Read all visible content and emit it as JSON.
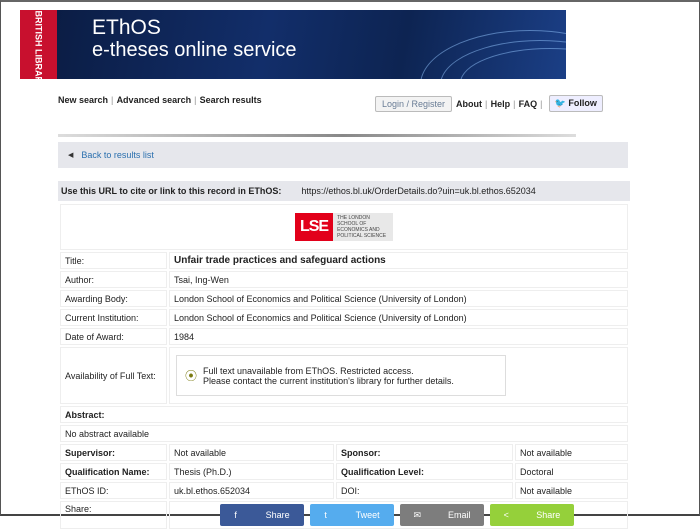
{
  "banner": {
    "logo": "BRITISH LIBRARY",
    "title": "EThOS",
    "subtitle": "e-theses online service"
  },
  "nav": {
    "left": [
      "New search",
      "Advanced search",
      "Search results"
    ],
    "login": "Login / Register",
    "right": [
      "About",
      "Help",
      "FAQ"
    ],
    "follow": "Follow"
  },
  "back": "Back to results list",
  "url": {
    "label": "Use this URL to cite or link to this record in EThOS:",
    "value": "https://ethos.bl.uk/OrderDetails.do?uin=uk.bl.ethos.652034"
  },
  "lse": {
    "mark": "LSE",
    "name": "THE LONDON SCHOOL OF ECONOMICS AND POLITICAL SCIENCE"
  },
  "record": {
    "title_label": "Title:",
    "title": "Unfair trade practices and safeguard actions",
    "author_label": "Author:",
    "author": "Tsai, Ing-Wen",
    "awarding_label": "Awarding Body:",
    "awarding": "London School of Economics and Political Science (University of London)",
    "institution_label": "Current Institution:",
    "institution": "London School of Economics and Political Science (University of London)",
    "date_label": "Date of Award:",
    "date": "1984",
    "avail_label": "Availability of Full Text:",
    "avail_1": "Full text unavailable from EThOS. Restricted access.",
    "avail_2": "Please contact the current institution's library for further details.",
    "abstract_label": "Abstract:",
    "abstract": "No abstract available",
    "supervisor_label": "Supervisor:",
    "supervisor": "Not available",
    "sponsor_label": "Sponsor:",
    "sponsor": "Not available",
    "qual_name_label": "Qualification Name:",
    "qual_name": "Thesis (Ph.D.)",
    "qual_level_label": "Qualification Level:",
    "qual_level": "Doctoral",
    "id_label": "EThOS ID:",
    "id": "uk.bl.ethos.652034",
    "doi_label": "DOI:",
    "doi": "Not available",
    "share_label": "Share:"
  },
  "share": [
    {
      "label": "Share",
      "icon": "f",
      "color": "#3b5998"
    },
    {
      "label": "Tweet",
      "icon": "t",
      "color": "#55acee"
    },
    {
      "label": "Email",
      "icon": "✉",
      "color": "#7d7d7d"
    },
    {
      "label": "Share",
      "icon": "<",
      "color": "#95d03a"
    }
  ]
}
